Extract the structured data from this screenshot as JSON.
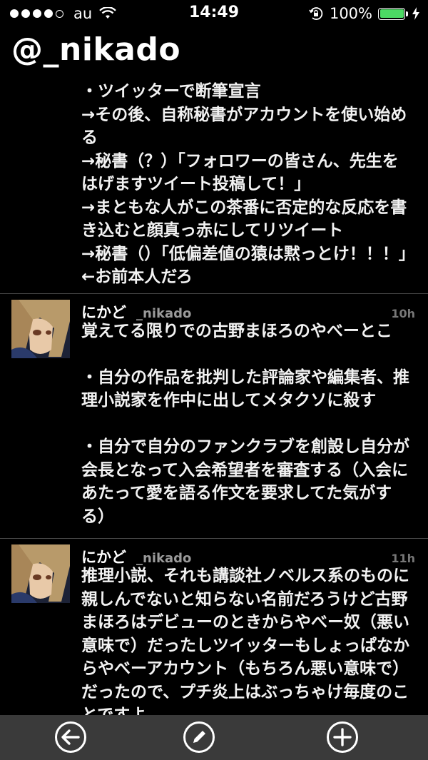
{
  "status_bar": {
    "carrier": "au",
    "time": "14:49",
    "battery_percent": "100%",
    "battery_level": 1.0,
    "signal_icons": [
      "signal-dot",
      "wifi-icon",
      "orientation-lock-icon",
      "battery-icon",
      "charging-bolt-icon"
    ]
  },
  "header": {
    "title": "@_nikado"
  },
  "first_tweet_tail": {
    "text": "・ツイッターで断筆宣言\n→その後、自称秘書がアカウントを使い始める\n→秘書（？）「フォロワーの皆さん、先生をはげますツイート投稿して！」\n→まともな人がこの茶番に否定的な反応を書き込むと顔真っ赤にしてリツイート\n→秘書（）「低偏差値の猿は黙っとけ！！！」←お前本人だろ"
  },
  "tweets": [
    {
      "name": "にかど",
      "handle": "_nikado",
      "time": "10h",
      "text": "覚えてる限りでの古野まほろのやべーとこ\n\n・自分の作品を批判した評論家や編集者、推理小説家を作中に出してメタクソに殺す\n\n・自分で自分のファンクラブを創設し自分が会長となって入会希望者を審査する（入会にあたって愛を語る作文を要求してた気がする）"
    },
    {
      "name": "にかど",
      "handle": "_nikado",
      "time": "11h",
      "text": "推理小説、それも講談社ノベルス系のものに親しんでないと知らない名前だろうけど古野まほろはデビューのときからやべー奴（悪い意味で）だったしツイッターもしょっぱなからやべーアカウント（もちろん悪い意味で）だったので、プチ炎上はぶっちゃけ毎度のことですよ"
    }
  ],
  "toolbar": {
    "buttons": [
      "back-arrow-icon",
      "compose-pencil-icon",
      "add-plus-icon"
    ]
  },
  "colors": {
    "background": "#000000",
    "toolbar": "#3a3a3a",
    "battery_green": "#4cd964",
    "handle_gray": "#9a9a9a"
  }
}
